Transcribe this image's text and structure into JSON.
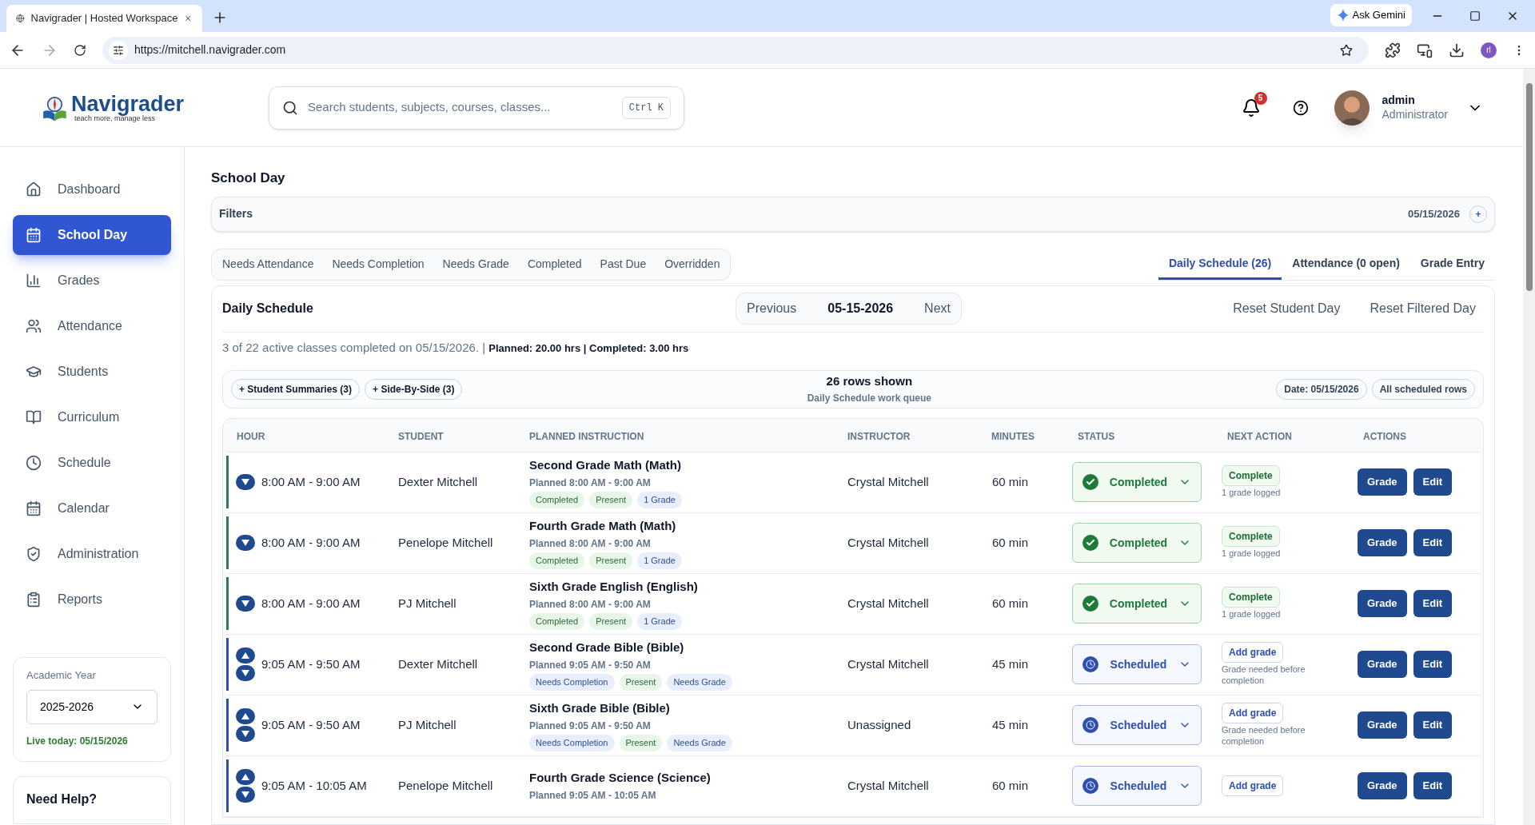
{
  "browser": {
    "tab_title": "Navigrader | Hosted Workspace",
    "url": "https://mitchell.navigrader.com",
    "ask": "Ask Gemini",
    "profile": "rl"
  },
  "header": {
    "brand": "Navigrader",
    "tagline": "teach more, manage less",
    "search_placeholder": "Search students, subjects, courses, classes...",
    "shortcut": "Ctrl K",
    "notifications": "5",
    "user": "admin",
    "role": "Administrator"
  },
  "sidebar": {
    "items": [
      {
        "label": "Dashboard",
        "selected": false
      },
      {
        "label": "School Day",
        "selected": true
      },
      {
        "label": "Grades",
        "selected": false
      },
      {
        "label": "Attendance",
        "selected": false
      },
      {
        "label": "Students",
        "selected": false
      },
      {
        "label": "Curriculum",
        "selected": false
      },
      {
        "label": "Schedule",
        "selected": false
      },
      {
        "label": "Calendar",
        "selected": false
      },
      {
        "label": "Administration",
        "selected": false
      },
      {
        "label": "Reports",
        "selected": false
      }
    ],
    "academic_year": {
      "label": "Academic Year",
      "value": "2025-2026",
      "live": "Live today: 05/15/2026"
    },
    "help": "Need Help?"
  },
  "page": {
    "title": "School Day",
    "filters": {
      "label": "Filters",
      "date": "05/15/2026",
      "add": "+"
    },
    "chips": [
      "Needs Attendance",
      "Needs Completion",
      "Needs Grade",
      "Completed",
      "Past Due",
      "Overridden"
    ],
    "view_tabs": [
      {
        "label": "Daily Schedule (26)",
        "selected": true
      },
      {
        "label": "Attendance (0 open)",
        "selected": false
      },
      {
        "label": "Grade Entry",
        "selected": false
      }
    ]
  },
  "schedule": {
    "title": "Daily Schedule",
    "previous": "Previous",
    "date": "05-15-2026",
    "next": "Next",
    "resets": [
      "Reset Student Day",
      "Reset Filtered Day"
    ],
    "summary": "3 of 22 active classes completed on 05/15/2026. | **Planned: 20.00 hrs | Completed: 3.00 hrs**",
    "toggles": [
      "+ Student Summaries (3)",
      "+ Side-By-Side (3)"
    ],
    "rows_shown": "26 rows shown",
    "queue": "Daily Schedule work queue",
    "filters": [
      "Date: 05/15/2026",
      "All scheduled rows"
    ],
    "columns": [
      "HOUR",
      "STUDENT",
      "PLANNED INSTRUCTION",
      "INSTRUCTOR",
      "MINUTES",
      "STATUS",
      "NEXT ACTION",
      "ACTIONS"
    ],
    "rows": [
      {
        "hour": "8:00 AM - 9:00 AM",
        "can_move_up": false,
        "student": "Dexter Mitchell",
        "course": "Second Grade Math (Math)",
        "planned": "Planned 8:00 AM - 9:00 AM",
        "tags": [
          {
            "label": "Completed",
            "kind": "success"
          },
          {
            "label": "Present",
            "kind": "success"
          },
          {
            "label": "1 Grade",
            "kind": "info"
          }
        ],
        "instructor": "Crystal Mitchell",
        "minutes": "60 min",
        "status": {
          "label": "Completed",
          "kind": "completed"
        },
        "next": {
          "label": "Complete",
          "note": "1 grade logged"
        },
        "actions": [
          "Grade",
          "Edit"
        ]
      },
      {
        "hour": "8:00 AM - 9:00 AM",
        "can_move_up": false,
        "student": "Penelope Mitchell",
        "course": "Fourth Grade Math (Math)",
        "planned": "Planned 8:00 AM - 9:00 AM",
        "tags": [
          {
            "label": "Completed",
            "kind": "success"
          },
          {
            "label": "Present",
            "kind": "success"
          },
          {
            "label": "1 Grade",
            "kind": "info"
          }
        ],
        "instructor": "Crystal Mitchell",
        "minutes": "60 min",
        "status": {
          "label": "Completed",
          "kind": "completed"
        },
        "next": {
          "label": "Complete",
          "note": "1 grade logged"
        },
        "actions": [
          "Grade",
          "Edit"
        ]
      },
      {
        "hour": "8:00 AM - 9:00 AM",
        "can_move_up": false,
        "student": "PJ Mitchell",
        "course": "Sixth Grade English (English)",
        "planned": "Planned 8:00 AM - 9:00 AM",
        "tags": [
          {
            "label": "Completed",
            "kind": "success"
          },
          {
            "label": "Present",
            "kind": "success"
          },
          {
            "label": "1 Grade",
            "kind": "info"
          }
        ],
        "instructor": "Crystal Mitchell",
        "minutes": "60 min",
        "status": {
          "label": "Completed",
          "kind": "completed"
        },
        "next": {
          "label": "Complete",
          "note": "1 grade logged"
        },
        "actions": [
          "Grade",
          "Edit"
        ]
      },
      {
        "hour": "9:05 AM - 9:50 AM",
        "can_move_up": true,
        "student": "Dexter Mitchell",
        "course": "Second Grade Bible (Bible)",
        "planned": "Planned 9:05 AM - 9:50 AM",
        "tags": [
          {
            "label": "Needs Completion",
            "kind": "info"
          },
          {
            "label": "Present",
            "kind": "success"
          },
          {
            "label": "Needs Grade",
            "kind": "info"
          }
        ],
        "instructor": "Crystal Mitchell",
        "minutes": "45 min",
        "status": {
          "label": "Scheduled",
          "kind": "scheduled"
        },
        "next": {
          "label": "Add grade",
          "note": "Grade needed before completion"
        },
        "actions": [
          "Grade",
          "Edit"
        ]
      },
      {
        "hour": "9:05 AM - 9:50 AM",
        "can_move_up": true,
        "student": "PJ Mitchell",
        "course": "Sixth Grade Bible (Bible)",
        "planned": "Planned 9:05 AM - 9:50 AM",
        "tags": [
          {
            "label": "Needs Completion",
            "kind": "info"
          },
          {
            "label": "Present",
            "kind": "success"
          },
          {
            "label": "Needs Grade",
            "kind": "info"
          }
        ],
        "instructor": "Unassigned",
        "minutes": "45 min",
        "status": {
          "label": "Scheduled",
          "kind": "scheduled"
        },
        "next": {
          "label": "Add grade",
          "note": "Grade needed before completion"
        },
        "actions": [
          "Grade",
          "Edit"
        ]
      },
      {
        "hour": "9:05 AM - 10:05 AM",
        "can_move_up": true,
        "student": "Penelope Mitchell",
        "course": "Fourth Grade Science (Science)",
        "planned": "Planned 9:05 AM - 10:05 AM",
        "instructor": "Crystal Mitchell",
        "minutes": "60 min",
        "status": {
          "label": "Scheduled",
          "kind": "scheduled"
        },
        "next": {
          "label": "Add grade"
        },
        "actions": [
          "Grade",
          "Edit"
        ]
      }
    ]
  }
}
